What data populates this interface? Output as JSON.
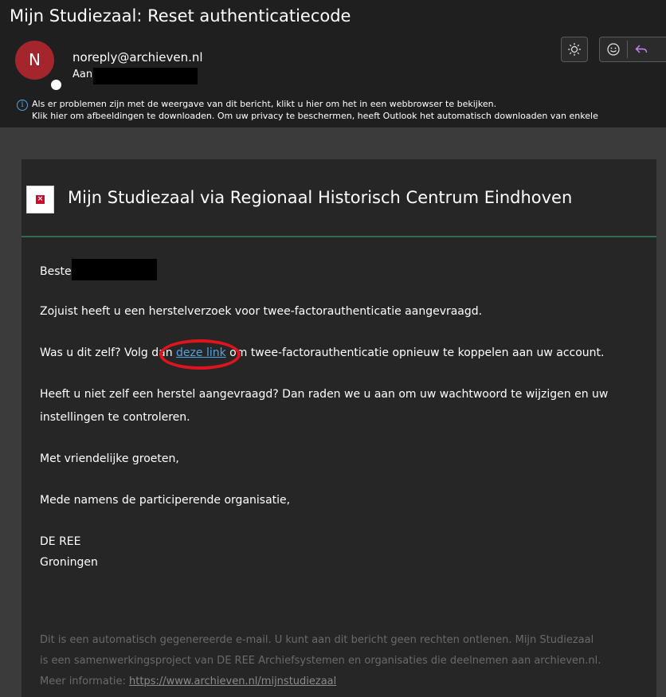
{
  "header": {
    "subject": "Mijn Studiezaal: Reset authenticatiecode",
    "avatar_initial": "N",
    "sender": "noreply@archieven.nl",
    "to_label": "Aan",
    "info_line_1": "Als er problemen zijn met de weergave van dit bericht, klikt u hier om het in een webbrowser te bekijken.",
    "info_line_2": "Klik hier om afbeeldingen te downloaden. Om uw privacy te beschermen, heeft Outlook het automatisch downloaden van enkele",
    "toolbar_icons": [
      "sun-icon",
      "emoji-icon",
      "reply-icon"
    ]
  },
  "colors": {
    "avatar_bg": "#a4262c",
    "link": "#4fa3e3",
    "accent_rule": "#2e6b50",
    "highlight_circle": "#e0141e"
  },
  "email": {
    "title": "Mijn Studiezaal via Regionaal Historisch Centrum Eindhoven",
    "greeting": "Beste",
    "paragraph_1": "Zojuist heeft u een herstelverzoek voor twee-factorauthenticatie aangevraagd.",
    "paragraph_2_before": "Was u dit zelf? Volg dan ",
    "paragraph_2_link": "deze link",
    "paragraph_2_after": " om twee-factorauthenticatie opnieuw te koppelen aan uw account.",
    "paragraph_3_line_1": "Heeft u niet zelf een herstel aangevraagd? Dan raden we u aan om uw wachtwoord te wijzigen en uw",
    "paragraph_3_line_2": "instellingen te controleren.",
    "closing": "Met vriendelijke groeten,",
    "on_behalf": "Mede namens de participerende organisatie,",
    "org_name": "DE REE",
    "org_city": "Groningen",
    "footer_line_1": "Dit is een automatisch gegenereerde e-mail. U kunt aan dit bericht geen rechten ontlenen. Mijn Studiezaal",
    "footer_line_2": "is een samenwerkingsproject van DE REE Archiefsystemen en organisaties die deelnemen aan archieven.nl.",
    "footer_line_3_prefix": "Meer informatie: ",
    "footer_link": "https://www.archieven.nl/mijnstudiezaal"
  }
}
